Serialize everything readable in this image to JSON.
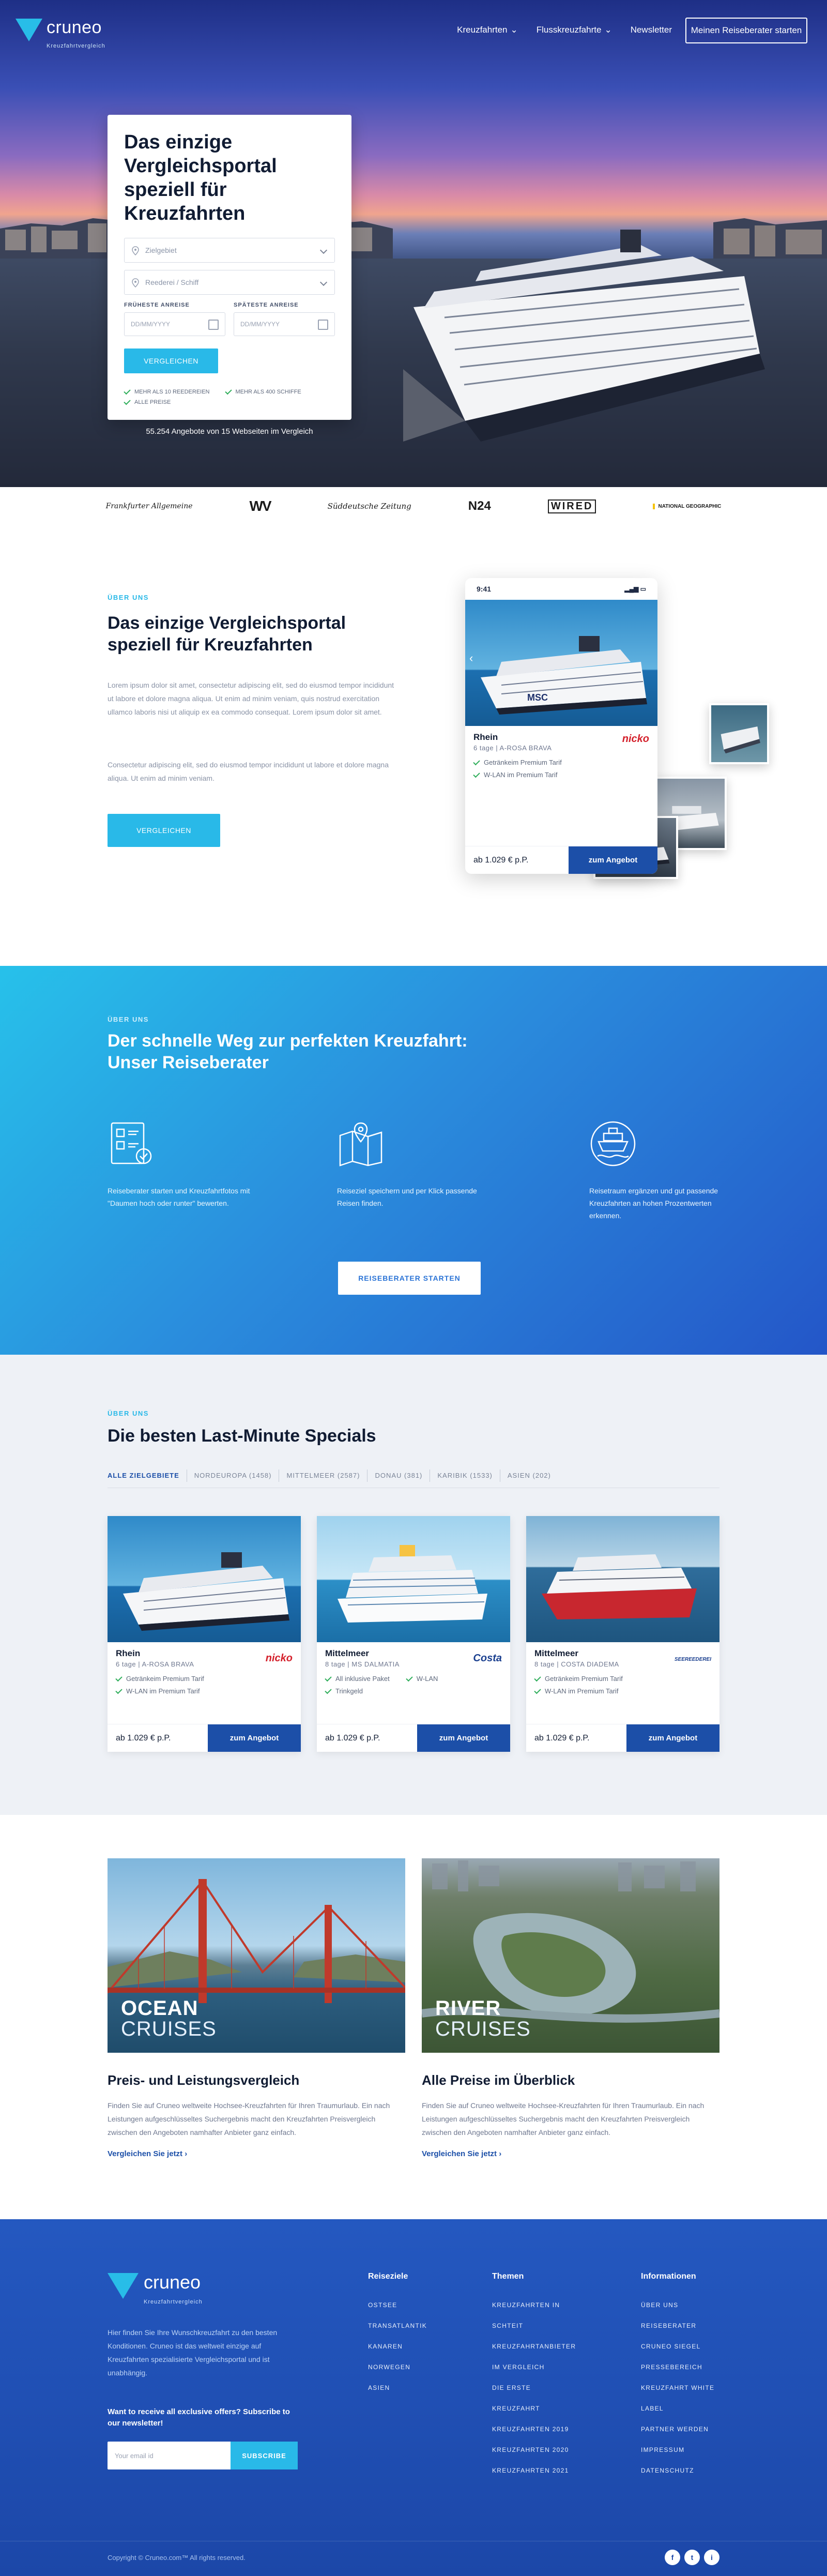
{
  "brand": {
    "name": "cruneo",
    "tagline": "Kreuzfahrtvergleich"
  },
  "nav": {
    "items": [
      {
        "label": "Kreuzfahrten"
      },
      {
        "label": "Flusskreuzfahrte"
      },
      {
        "label": "Newsletter"
      }
    ],
    "cta": "Meinen Reiseberater starten"
  },
  "search": {
    "title": "Das einzige Vergleichsportal speziell für Kreuzfahrten",
    "destination_placeholder": "Zielgebiet",
    "ship_placeholder": "Reederei / Schiff",
    "earliest_label": "FRÜHESTE ANREISE",
    "latest_label": "SPÄTESTE ANREISE",
    "date_placeholder": "DD/MM/YYYY",
    "button": "VERGLEICHEN",
    "checks": [
      "MEHR ALS 10 REEDEREIEN",
      "MEHR ALS 400 SCHIFFE",
      "ALLE PREISE"
    ],
    "offers": "55.254 Angebote von 15 Webseiten im Vergleich"
  },
  "press": [
    "Frankfurter Allgemeine",
    "WV",
    "Süddeutsche Zeitung",
    "N24",
    "WIRED",
    "NATIONAL GEOGRAPHIC"
  ],
  "about": {
    "eyebrow": "ÜBER UNS",
    "title": "Das einzige Vergleichsportal speziell für Kreuzfahrten",
    "p1": "Lorem ipsum dolor sit amet, consectetur adipiscing elit, sed do eiusmod tempor incididunt ut labore et dolore magna aliqua. Ut enim ad minim veniam, quis nostrud exercitation ullamco laboris nisi ut aliquip ex ea commodo consequat. Lorem ipsum dolor sit amet.",
    "p2": "Consectetur adipiscing elit, sed do eiusmod tempor incididunt ut labore et dolore magna aliqua. Ut enim ad minim veniam.",
    "button": "VERGLEICHEN",
    "phone": {
      "time": "9:41",
      "name": "Rhein",
      "days": "6 tage",
      "ship": "A-ROSA BRAVA",
      "brand": "nicko",
      "features": [
        "Getränkeim Premium Tarif",
        "W-LAN im Premium Tarif"
      ],
      "price": "ab 1.029 € p.P.",
      "cta": "zum Angebot"
    }
  },
  "advisor": {
    "eyebrow": "ÜBER UNS",
    "title": "Der schnelle Weg zur perfekten Kreuzfahrt: Unser Reiseberater",
    "steps": [
      {
        "icon": "form-icon",
        "text": "Reiseberater starten und Kreuzfahrtfotos mit \"Daumen hoch oder runter\" bewerten."
      },
      {
        "icon": "map-icon",
        "text": "Reiseziel speichern und per Klick passende Reisen finden."
      },
      {
        "icon": "ship-icon",
        "text": "Reisetraum ergänzen und gut passende Kreuzfahrten an hohen Prozentwerten erkennen."
      }
    ],
    "button": "REISEBERATER STARTEN"
  },
  "lastminute": {
    "eyebrow": "ÜBER UNS",
    "title": "Die besten Last-Minute Specials",
    "filters": [
      "ALLE ZIELGEBIETE",
      "NORDEUROPA (1458)",
      "MITTELMEER (2587)",
      "DONAU (381)",
      "KARIBIK (1533)",
      "ASIEN (202)"
    ],
    "deals": [
      {
        "name": "Rhein",
        "days": "6 tage",
        "ship": "A-ROSA BRAVA",
        "brand": "nicko",
        "features": [
          "Getränkeim Premium Tarif",
          "W-LAN im Premium Tarif"
        ],
        "price": "ab 1.029 € p.P.",
        "cta": "zum Angebot"
      },
      {
        "name": "Mittelmeer",
        "days": "8 tage",
        "ship": "MS DALMATIA",
        "brand": "Costa",
        "features": [
          "All inklusive Paket",
          "W-LAN",
          "Trinkgeld"
        ],
        "price": "ab 1.029 € p.P.",
        "cta": "zum Angebot"
      },
      {
        "name": "Mittelmeer",
        "days": "8 tage",
        "ship": "COSTA DIADEMA",
        "brand": "SEEREEDEREI",
        "features": [
          "Getränkeim Premium Tarif",
          "W-LAN im Premium Tarif"
        ],
        "price": "ab 1.029 € p.P.",
        "cta": "zum Angebot"
      }
    ]
  },
  "pillars": [
    {
      "overlay_big": "OCEAN",
      "overlay_small": "CRUISES",
      "title": "Preis- und Leistungsvergleich",
      "text": "Finden Sie auf Cruneo weltweite Hochsee-Kreuzfahrten für Ihren Traumurlaub. Ein nach Leistungen aufgeschlüsseltes Suchergebnis macht den Kreuzfahrten Preisvergleich zwischen den Angeboten namhafter Anbieter ganz einfach.",
      "link": "Vergleichen Sie jetzt ›"
    },
    {
      "overlay_big": "RIVER",
      "overlay_small": "CRUISES",
      "title": "Alle Preise im Überblick",
      "text": "Finden Sie auf Cruneo weltweite Hochsee-Kreuzfahrten für Ihren Traumurlaub. Ein nach Leistungen aufgeschlüsseltes Suchergebnis macht den Kreuzfahrten Preisvergleich zwischen den Angeboten namhafter Anbieter ganz einfach.",
      "link": "Vergleichen Sie jetzt ›"
    }
  ],
  "footer": {
    "desc": "Hier finden Sie Ihre Wunschkreuzfahrt zu den besten Konditionen. Cruneo ist das weltweit einzige auf Kreuzfahrten spezialisierte Vergleichsportal und ist unabhängig.",
    "newsletter": "Want to receive all exclusive offers? Subscribe to our newsletter!",
    "email_placeholder": "Your email id",
    "subscribe": "SUBSCRIBE",
    "cols": [
      {
        "title": "Reiseziele",
        "links": [
          "OSTSEE",
          "TRANSATLANTIK",
          "KANAREN",
          "NORWEGEN",
          "ASIEN"
        ]
      },
      {
        "title": "Themen",
        "links": [
          "KREUZFAHRTEN IN",
          "SCHTEIT",
          "KREUZFAHRTANBIETER",
          "IM VERGLEICH",
          "DIE ERSTE",
          "KREUZFAHRT",
          "KREUZFAHRTEN 2019",
          "KREUZFAHRTEN 2020",
          "KREUZFAHRTEN 2021"
        ]
      },
      {
        "title": "Informationen",
        "links": [
          "ÜBER UNS",
          "REISEBERATER",
          "CRUNEO SIEGEL",
          "PRESSEBEREICH",
          "KREUZFAHRT WHITE",
          "LABEL",
          "PARTNER WERDEN",
          "IMPRESSUM",
          "DATENSCHUTZ"
        ]
      }
    ],
    "copyright": "Copyright © Cruneo.com™  All rights reserved.",
    "social": [
      "f",
      "t",
      "i"
    ]
  },
  "colors": {
    "accent": "#29b9e8",
    "primary": "#1c4fa8",
    "check": "#2fae5a"
  }
}
